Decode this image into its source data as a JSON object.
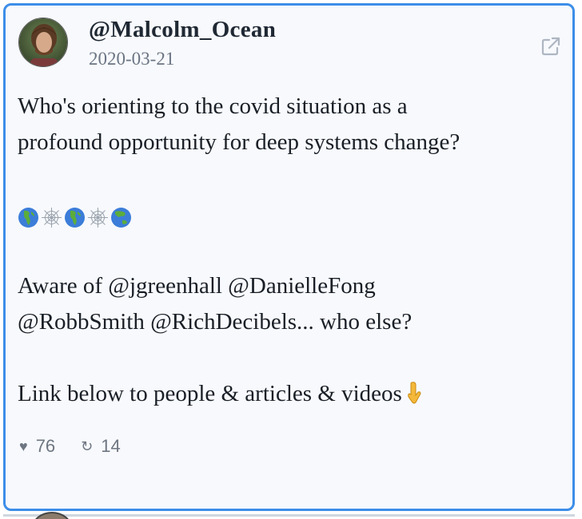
{
  "tweet": {
    "author": "@Malcolm_Ocean",
    "date": "2020-03-21",
    "lines": [
      "Who's orienting to the covid situation as a",
      "profound opportunity for deep systems change?"
    ],
    "emojis": [
      "globe-europe-africa",
      "spider-web",
      "globe-europe-africa",
      "spider-web",
      "globe-asia-australia"
    ],
    "aware_line_1": "Aware of @jgreenhall @DanielleFong",
    "aware_line_2": "@RobbSmith @RichDecibels... who else?",
    "link_line": "Link below to people & articles & videos",
    "link_emoji": "backhand-index-pointing-down",
    "likes": "76",
    "retweets": "14",
    "like_icon": "♥",
    "retweet_icon": "↻"
  },
  "colors": {
    "card_border": "#3d8ee8",
    "card_background": "#f7f9fd",
    "author_text": "#1f2833",
    "date_text": "#6b7583",
    "stat_text": "#6e7681"
  }
}
